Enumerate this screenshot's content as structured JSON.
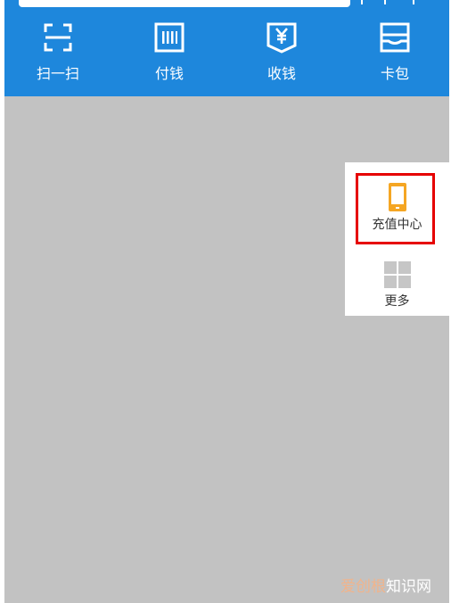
{
  "toolbar": {
    "actions": [
      {
        "label": "扫一扫",
        "icon": "scan-icon"
      },
      {
        "label": "付钱",
        "icon": "barcode-pay-icon"
      },
      {
        "label": "收钱",
        "icon": "yuan-receive-icon"
      },
      {
        "label": "卡包",
        "icon": "card-wallet-icon"
      }
    ]
  },
  "side_panel": {
    "recharge": {
      "label": "充值中心",
      "icon": "phone-icon"
    },
    "more": {
      "label": "更多",
      "icon": "grid-icon"
    }
  },
  "watermark": {
    "brand": "爱创根",
    "site": "知识网"
  },
  "colors": {
    "toolbar_blue": "#1e87dc",
    "overlay_gray": "#c2c2c2",
    "highlight_red": "#e60000",
    "phone_orange": "#f5a623"
  }
}
